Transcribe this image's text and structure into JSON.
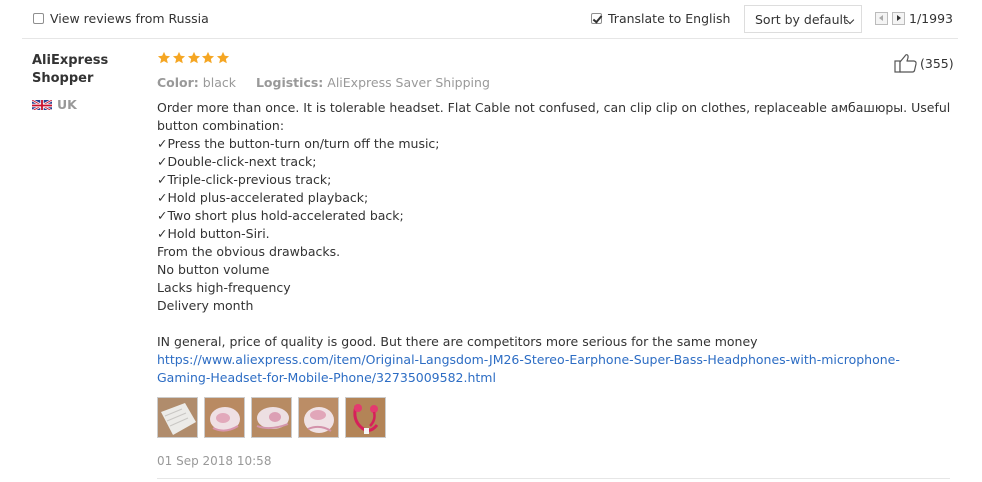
{
  "toolbar": {
    "russia_label": "View reviews from Russia",
    "translate_label": "Translate to English",
    "sort_label": "Sort by default",
    "page_indicator": "1/1993"
  },
  "review": {
    "user_name": "AliExpress Shopper",
    "country": "UK",
    "rating": 5,
    "color_label": "Color:",
    "color_value": "black",
    "logistics_label": "Logistics:",
    "logistics_value": "AliExpress Saver Shipping",
    "likes": "(355)",
    "lines": [
      "Order more than once. It is tolerable headset. Flat Cable not confused, can clip clip on clothes, replaceable амбашюры. Useful button combination:",
      "✓Press the button-turn on/turn off the music;",
      "✓Double-click-next track;",
      "✓Triple-click-previous track;",
      "✓Hold plus-accelerated playback;",
      "✓Two short plus hold-accelerated back;",
      "✓Hold button-Siri.",
      "From the obvious drawbacks.",
      "No button volume",
      "Lacks high-frequency",
      "Delivery month",
      "",
      "IN general, price of quality is good. But there are competitors more serious for the same money"
    ],
    "link": "https://www.aliexpress.com/item/Original-Langsdom-JM26-Stereo-Earphone-Super-Bass-Headphones-with-microphone-Gaming-Headset-for-Mobile-Phone/32735009582.html",
    "date": "01 Sep 2018 10:58"
  },
  "colors": {
    "star": "#f5a623",
    "link": "#2d6dc4",
    "muted": "#999999"
  }
}
